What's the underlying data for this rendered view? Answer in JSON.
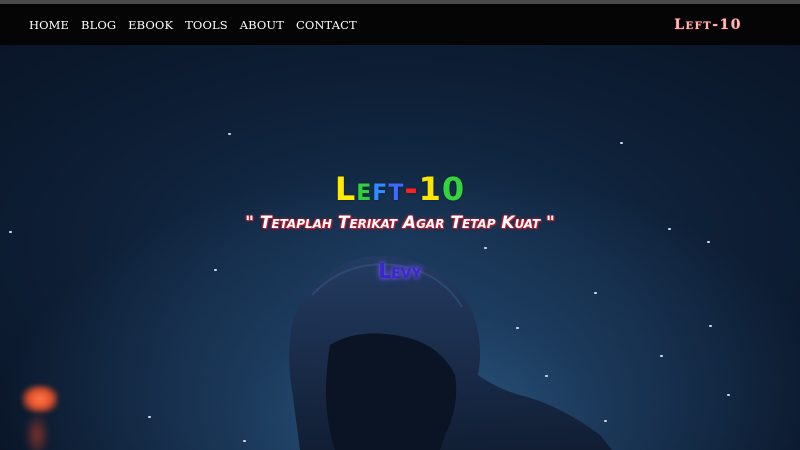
{
  "nav": {
    "items": [
      {
        "label": "HOME"
      },
      {
        "label": "BLOG"
      },
      {
        "label": "EBOOK"
      },
      {
        "label": "TOOLS"
      },
      {
        "label": "ABOUT"
      },
      {
        "label": "CONTACT"
      }
    ],
    "brand": "Left-10"
  },
  "hero": {
    "title_letters": [
      {
        "char": "L",
        "color": "#ffea00"
      },
      {
        "char": "e",
        "color": "#30d23a"
      },
      {
        "char": "f",
        "color": "#2f8cff"
      },
      {
        "char": "t",
        "color": "#3e6bff"
      },
      {
        "char": "-",
        "color": "#ff2020"
      },
      {
        "char": "1",
        "color": "#ffe600"
      },
      {
        "char": "0",
        "color": "#34d43c"
      }
    ],
    "quote": "\" Tetaplah Terikat Agar Tetap Kuat \"",
    "author": "Levy"
  },
  "colors": {
    "navbar_bg": "#050505",
    "brand_text": "#ffb8b8",
    "quote_shadow": "#c41a2a",
    "author_text": "#3a28c8"
  }
}
